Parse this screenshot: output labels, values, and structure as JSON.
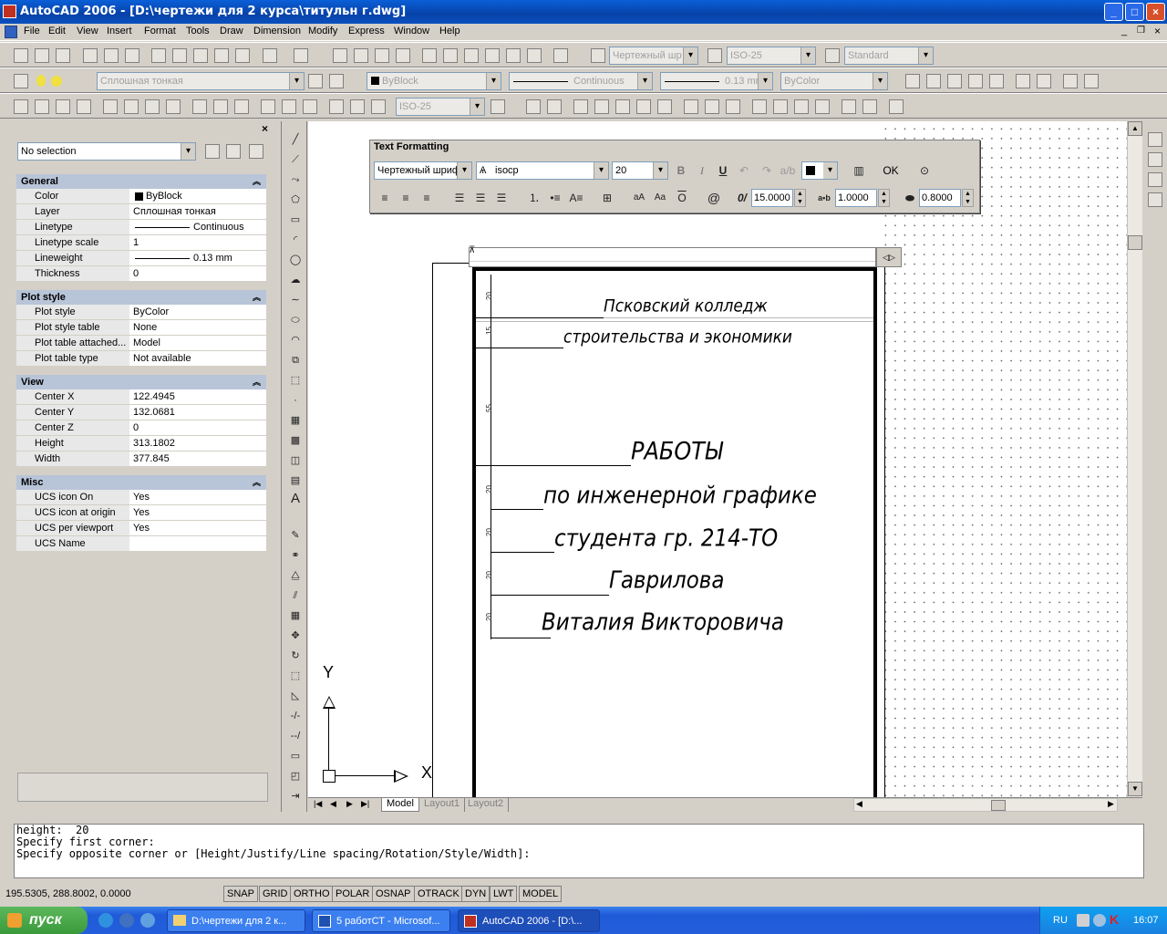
{
  "window": {
    "title": "AutoCAD 2006 - [D:\\чертежи для 2 курса\\титульн г.dwg]",
    "controls": {
      "minimize": "_",
      "maximize": "□",
      "close": "×"
    }
  },
  "menu": [
    "File",
    "Edit",
    "View",
    "Insert",
    "Format",
    "Tools",
    "Draw",
    "Dimension",
    "Modify",
    "Express",
    "Window",
    "Help"
  ],
  "toolbar": {
    "text_style": "Чертежный шр",
    "dim_style": "ISO-25",
    "table_style": "Standard",
    "layer": "Сплошная тонкая",
    "color": "ByBlock",
    "linetype": "Continuous",
    "lineweight": "0.13 mm",
    "plotstyle": "ByColor",
    "dim_style2": "ISO-25"
  },
  "properties": {
    "selection": "No selection",
    "sections": [
      {
        "title": "General",
        "rows": [
          {
            "k": "Color",
            "v": "ByBlock"
          },
          {
            "k": "Layer",
            "v": "Сплошная тонкая"
          },
          {
            "k": "Linetype",
            "v": "Continuous"
          },
          {
            "k": "Linetype scale",
            "v": "1"
          },
          {
            "k": "Lineweight",
            "v": "0.13 mm"
          },
          {
            "k": "Thickness",
            "v": "0"
          }
        ]
      },
      {
        "title": "Plot style",
        "rows": [
          {
            "k": "Plot style",
            "v": "ByColor"
          },
          {
            "k": "Plot style table",
            "v": "None"
          },
          {
            "k": "Plot table attached...",
            "v": "Model"
          },
          {
            "k": "Plot table type",
            "v": "Not available"
          }
        ]
      },
      {
        "title": "View",
        "rows": [
          {
            "k": "Center X",
            "v": "122.4945"
          },
          {
            "k": "Center Y",
            "v": "132.0681"
          },
          {
            "k": "Center Z",
            "v": "0"
          },
          {
            "k": "Height",
            "v": "313.1802"
          },
          {
            "k": "Width",
            "v": "377.845"
          }
        ]
      },
      {
        "title": "Misc",
        "rows": [
          {
            "k": "UCS icon On",
            "v": "Yes"
          },
          {
            "k": "UCS icon at origin",
            "v": "Yes"
          },
          {
            "k": "UCS per viewport",
            "v": "Yes"
          },
          {
            "k": "UCS Name",
            "v": ""
          }
        ]
      }
    ]
  },
  "text_formatting": {
    "title": "Text Formatting",
    "style": "Чертежный шриф",
    "font": "isocp",
    "height": "20",
    "ok": "OK",
    "oblique": "15.0000",
    "tracking": "1.0000",
    "width_factor": "0.8000"
  },
  "drawing": {
    "lines": [
      "Псковский колледж",
      "строительства и экономики",
      "РАБОТЫ",
      "по инженерной графике",
      "студента гр. 214-ТО",
      "Гаврилова",
      "Виталия Викторовича"
    ],
    "dims": [
      "20",
      "15",
      "55",
      "20",
      "20",
      "20",
      "20"
    ],
    "ucs": {
      "y": "Y",
      "x": "X"
    }
  },
  "tabs": [
    "Model",
    "Layout1",
    "Layout2"
  ],
  "command": {
    "lines": [
      "height:  20",
      "Specify first corner:",
      "Specify opposite corner or [Height/Justify/Line spacing/Rotation/Style/Width]:"
    ]
  },
  "status": {
    "coords": "195.5305, 288.8002, 0.0000",
    "buttons": [
      "SNAP",
      "GRID",
      "ORTHO",
      "POLAR",
      "OSNAP",
      "OTRACK",
      "DYN",
      "LWT",
      "MODEL"
    ]
  },
  "taskbar": {
    "start": "пуск",
    "tasks": [
      "D:\\чертежи для 2 к...",
      "5 работСТ - Microsof...",
      "AutoCAD 2006 - [D:\\..."
    ],
    "lang": "RU",
    "time": "16:07"
  }
}
